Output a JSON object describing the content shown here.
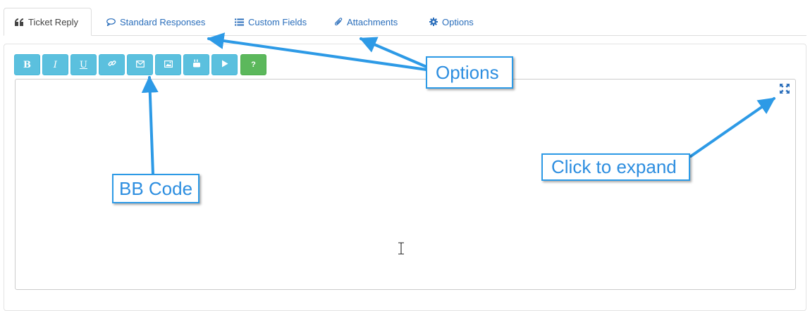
{
  "tabs": [
    {
      "label": "Ticket Reply",
      "icon": "quote-icon",
      "active": true
    },
    {
      "label": "Standard Responses",
      "icon": "comment-icon",
      "active": false
    },
    {
      "label": "Custom Fields",
      "icon": "list-icon",
      "active": false
    },
    {
      "label": "Attachments",
      "icon": "paperclip-icon",
      "active": false
    },
    {
      "label": "Options",
      "icon": "gear-icon",
      "active": false
    }
  ],
  "toolbar": {
    "bold": "B",
    "italic": "I",
    "underline": "U",
    "help": "?",
    "buttons": [
      "bold",
      "italic",
      "underline",
      "link-icon",
      "email-icon",
      "image-icon",
      "youtube-icon",
      "video-play-icon",
      "help"
    ]
  },
  "editor": {
    "value": ""
  },
  "callouts": {
    "options": "Options",
    "bb_code": "BB Code",
    "expand": "Click to expand"
  },
  "colors": {
    "tab_link": "#2a6ebb",
    "button_info": "#5bc0de",
    "button_success": "#5cb85c",
    "callout": "#2d9ae6"
  }
}
